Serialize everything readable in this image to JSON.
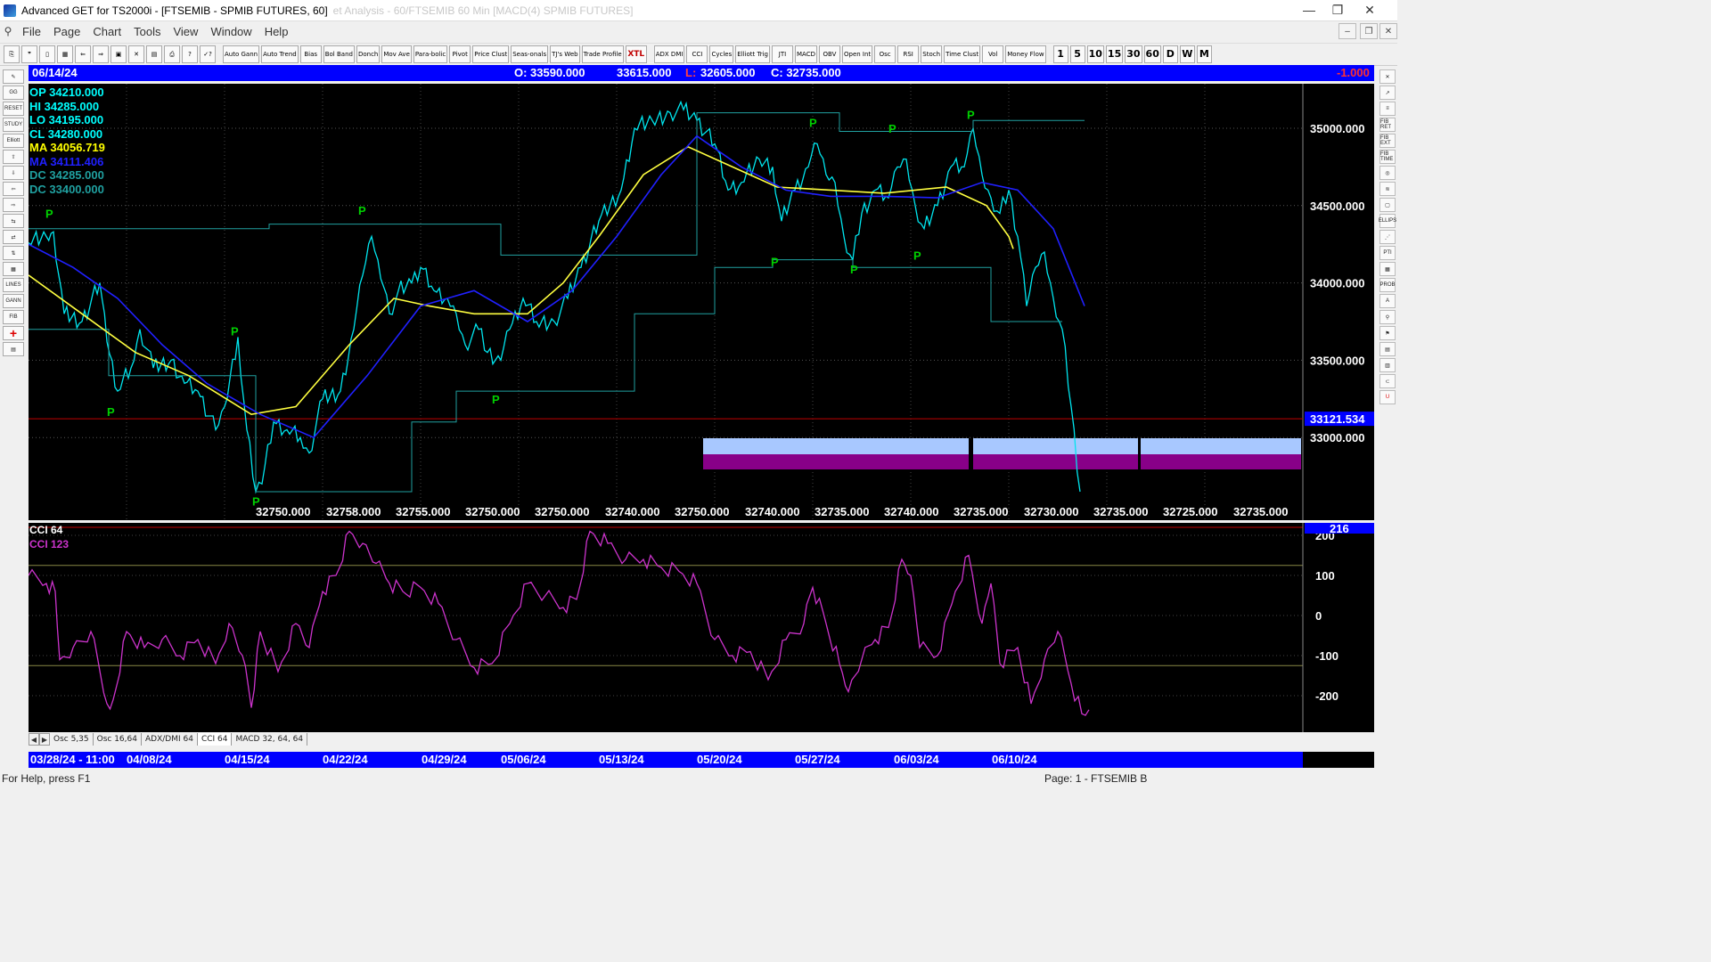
{
  "window": {
    "title": "Advanced GET for TS2000i - [FTSEMIB - SPMIB FUTURES, 60]",
    "ghost_text": "et Analysis - 60/FTSEMIB 60 Min [MACD(4) SPMIB FUTURES]",
    "minimize": "—",
    "restore": "❐",
    "close": "✕"
  },
  "menu": {
    "items": [
      "File",
      "Page",
      "Chart",
      "Tools",
      "View",
      "Window",
      "Help"
    ],
    "mdi": [
      "–",
      "❐",
      "✕"
    ]
  },
  "toolbar": {
    "file_buttons": [
      "⎘",
      "❞",
      "▯",
      "▦",
      "⇐",
      "⇒",
      "▣",
      "✕",
      "▤",
      "⎙",
      "?",
      "✓?"
    ],
    "study_buttons": [
      "Auto Gann",
      "Auto Trend",
      "Bias",
      "Bol Band",
      "Donch",
      "Mov Ave",
      "Para-bolic",
      "Pivot",
      "Price Clust",
      "Seas-onals",
      "TJ's Web",
      "Trade Profile",
      "XTL"
    ],
    "osc_buttons": [
      "ADX DMI",
      "CCI",
      "Cycles",
      "Elliott Trig",
      "JTI",
      "MACD",
      "OBV",
      "Open Int",
      "Osc",
      "RSI",
      "Stoch",
      "Time Clust",
      "Vol",
      "Money Flow"
    ],
    "interval_buttons": [
      "1",
      "5",
      "10",
      "15",
      "30",
      "60",
      "D",
      "W",
      "M"
    ]
  },
  "left_tools": [
    "✎",
    "GG",
    "RESET",
    "STUDY",
    "Elliott",
    "⇧",
    "⇩",
    "⇦",
    "⇨",
    "⇆",
    "⇄",
    "⇅",
    "▦",
    "LINES",
    "GANN",
    "FIB",
    "+",
    "▤"
  ],
  "right_tools": [
    "✕",
    "↗",
    "≡",
    "FIB RET",
    "FIB EXT",
    "FIB TIME",
    "◎",
    "≋",
    "▢",
    "ELLIPS",
    "⋰",
    "PTI",
    "▦",
    "PROB",
    "A",
    "⚲",
    "⚑",
    "▤",
    "▥",
    "⊂",
    "U"
  ],
  "info_bar": {
    "date": "06/14/24",
    "open": "O: 33590.000",
    "high": "33615.000",
    "low_label": "L:",
    "low": "32605.000",
    "close": "C: 32735.000",
    "change": "-1.000"
  },
  "ohlc_legend": [
    {
      "text": "OP  34210.000",
      "color": "#00ffff"
    },
    {
      "text": "HI   34285.000",
      "color": "#00ffff"
    },
    {
      "text": "LO  34195.000",
      "color": "#00ffff"
    },
    {
      "text": "CL  34280.000",
      "color": "#00ffff"
    },
    {
      "text": "MA  34056.719",
      "color": "#ffff00"
    },
    {
      "text": "MA  34111.406",
      "color": "#2020ff"
    },
    {
      "text": "DC  34285.000",
      "color": "#20a0a0"
    },
    {
      "text": "DC  33400.000",
      "color": "#20a0a0"
    }
  ],
  "price_axis": {
    "ticks": [
      "35000.000",
      "34500.000",
      "34000.000",
      "33500.000",
      "33000.000"
    ],
    "current_price": "33121.534"
  },
  "bottom_price_labels": [
    "32750.000",
    "32758.000",
    "32755.000",
    "32750.000",
    "32750.000",
    "32740.000",
    "32750.000",
    "32740.000",
    "32735.000",
    "32740.000",
    "32735.000",
    "32730.000",
    "32735.000",
    "32725.000",
    "32735.000"
  ],
  "pivot_label": "P",
  "cci_panel": {
    "title1": "CCI 64",
    "title2": "CCI  123",
    "value_badge": "216",
    "ticks": [
      "200",
      "100",
      "0",
      "-100",
      "-200"
    ]
  },
  "tabs": [
    "Osc 5,35",
    "Osc 16,64",
    "ADX/DMI 64",
    "CCI 64",
    "MACD 32, 64, 64"
  ],
  "tab_nav": [
    "◀",
    "▶"
  ],
  "date_axis": [
    "03/28/24 - 11:00",
    "04/08/24",
    "04/15/24",
    "04/22/24",
    "04/29/24",
    "05/06/24",
    "05/13/24",
    "05/20/24",
    "05/27/24",
    "06/03/24",
    "06/10/24"
  ],
  "status": {
    "help": "For Help, press F1",
    "page": "Page: 1 - FTSEMIB B"
  },
  "colors": {
    "price": "#00e5ee",
    "ma_fast": "#ffff40",
    "ma_slow": "#2020ff",
    "donchian": "#20a0a0",
    "cci": "#cc33cc",
    "pivot": "#00d000",
    "header_blue": "#0000ff",
    "zone_light": "#a8c8ff",
    "zone_purple": "#880088"
  }
}
